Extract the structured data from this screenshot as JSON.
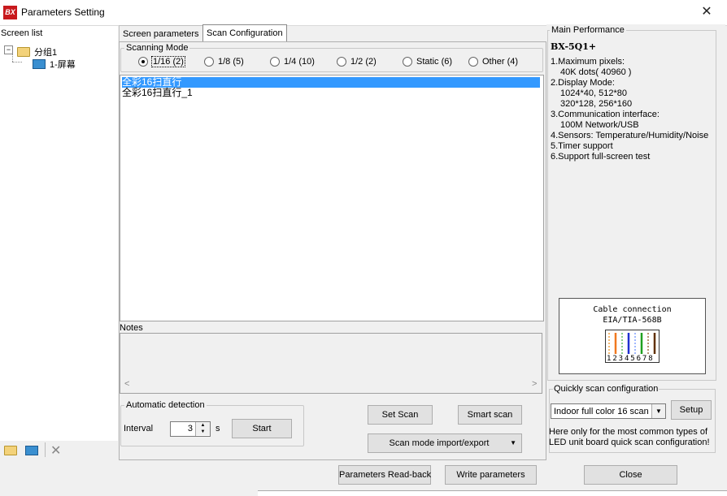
{
  "window": {
    "app_icon": "bx-app-icon",
    "title": "Parameters Setting",
    "close_icon": "close-icon"
  },
  "screen_list": {
    "label": "Screen list",
    "group": {
      "label": "分组1",
      "icon": "folder-icon",
      "expanded": true
    },
    "screen": {
      "label": "1-屏幕",
      "icon": "monitor-icon"
    },
    "toolbar": [
      "add-group-icon",
      "add-screen-icon",
      "delete-icon"
    ]
  },
  "tabs": [
    {
      "label": "Screen parameters",
      "active": false
    },
    {
      "label": "Scan Configuration",
      "active": true
    }
  ],
  "scanning_mode": {
    "label": "Scanning Mode",
    "options": [
      {
        "label": "1/16 (2)",
        "selected": true
      },
      {
        "label": "1/8 (5)",
        "selected": false
      },
      {
        "label": "1/4 (10)",
        "selected": false
      },
      {
        "label": "1/2 (2)",
        "selected": false
      },
      {
        "label": "Static (6)",
        "selected": false
      },
      {
        "label": "Other (4)",
        "selected": false
      }
    ]
  },
  "scan_list": [
    {
      "label": "全彩16扫直行",
      "selected": true
    },
    {
      "label": "全彩16扫直行_1",
      "selected": false
    }
  ],
  "notes": {
    "label": "Notes",
    "value": ""
  },
  "auto_detect": {
    "label": "Automatic detection",
    "interval_label": "Interval",
    "interval_value": "3",
    "unit": "s",
    "start_button": "Start"
  },
  "buttons": {
    "set_scan": "Set Scan",
    "smart_scan": "Smart scan",
    "import_export": "Scan mode import/export"
  },
  "main_performance": {
    "label": "Main Performance",
    "model": "BX-5Q1+",
    "lines": [
      "1.Maximum pixels:",
      "    40K dots( 40960 )",
      "2.Display Mode:",
      "    1024*40, 512*80",
      "    320*128, 256*160",
      "3.Communication interface:",
      "    100M Network/USB",
      "4.Sensors: Temperature/Humidity/Noise",
      "5.Timer support",
      "6.Support full-screen test"
    ],
    "cable": {
      "title": "Cable connection",
      "standard": "EIA/TIA-568B",
      "pins": "12345678",
      "wire_colors": [
        "#f0a040",
        "#f07820",
        "#60c060",
        "#2030d0",
        "#80a0ff",
        "#20a020",
        "#a07040",
        "#603000"
      ]
    }
  },
  "quick_scan": {
    "label": "Quickly scan configuration",
    "selected": "Indoor full color 16 scan",
    "setup_button": "Setup",
    "help": "Here only for the most common types of LED unit board quick scan configuration!"
  },
  "footer": {
    "readback": "Parameters Read-back",
    "write": "Write parameters",
    "close": "Close"
  }
}
